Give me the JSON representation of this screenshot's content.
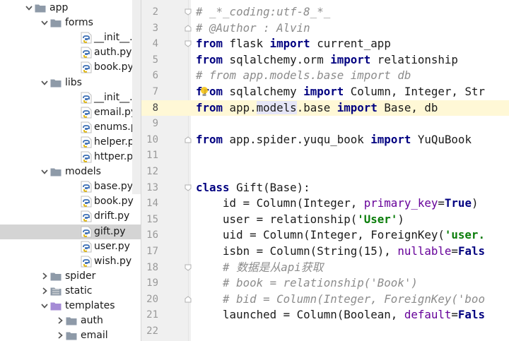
{
  "project_tree": {
    "rows": [
      {
        "label": "app",
        "kind": "folder",
        "depth": 0,
        "arrow": "open"
      },
      {
        "label": "forms",
        "kind": "folder",
        "depth": 1,
        "arrow": "open"
      },
      {
        "label": "__init__.py",
        "kind": "py",
        "depth": 2
      },
      {
        "label": "auth.py",
        "kind": "py",
        "depth": 2
      },
      {
        "label": "book.py",
        "kind": "py",
        "depth": 2
      },
      {
        "label": "libs",
        "kind": "folder",
        "depth": 1,
        "arrow": "open"
      },
      {
        "label": "__init__.py",
        "kind": "py",
        "depth": 2
      },
      {
        "label": "email.py",
        "kind": "py",
        "depth": 2
      },
      {
        "label": "enums.py",
        "kind": "py",
        "depth": 2
      },
      {
        "label": "helper.py",
        "kind": "py",
        "depth": 2
      },
      {
        "label": "httper.py",
        "kind": "py",
        "depth": 2
      },
      {
        "label": "models",
        "kind": "folder",
        "depth": 1,
        "arrow": "open"
      },
      {
        "label": "base.py",
        "kind": "py",
        "depth": 2
      },
      {
        "label": "book.py",
        "kind": "py",
        "depth": 2
      },
      {
        "label": "drift.py",
        "kind": "py",
        "depth": 2
      },
      {
        "label": "gift.py",
        "kind": "py",
        "depth": 2,
        "selected": true
      },
      {
        "label": "user.py",
        "kind": "py",
        "depth": 2
      },
      {
        "label": "wish.py",
        "kind": "py",
        "depth": 2
      },
      {
        "label": "spider",
        "kind": "folder",
        "depth": 1,
        "arrow": "closed"
      },
      {
        "label": "static",
        "kind": "folder-static",
        "depth": 1,
        "arrow": "closed"
      },
      {
        "label": "templates",
        "kind": "folder-purple",
        "depth": 1,
        "arrow": "open"
      },
      {
        "label": "auth",
        "kind": "folder",
        "depth": 2,
        "arrow": "closed"
      },
      {
        "label": "email",
        "kind": "folder",
        "depth": 2,
        "arrow": "closed"
      }
    ]
  },
  "editor": {
    "current_line": 8,
    "lines": [
      {
        "n": 2,
        "fold": "start",
        "tokens": [
          {
            "t": "# _*_coding:utf-8_*_",
            "c": "c"
          }
        ]
      },
      {
        "n": 3,
        "fold": "end",
        "tokens": [
          {
            "t": "# @Author : Alvin",
            "c": "c"
          }
        ]
      },
      {
        "n": 4,
        "fold": "start",
        "tokens": [
          {
            "t": "from",
            "c": "k"
          },
          {
            "t": " flask "
          },
          {
            "t": "import",
            "c": "k"
          },
          {
            "t": " current_app"
          }
        ]
      },
      {
        "n": 5,
        "tokens": [
          {
            "t": "from",
            "c": "k"
          },
          {
            "t": " sqlalchemy.orm "
          },
          {
            "t": "import",
            "c": "k"
          },
          {
            "t": " relationship"
          }
        ]
      },
      {
        "n": 6,
        "tokens": [
          {
            "t": "# from app.models.base import db",
            "c": "c"
          }
        ]
      },
      {
        "n": 7,
        "bulb": true,
        "tokens": [
          {
            "t": "from",
            "c": "k"
          },
          {
            "t": " sqlalchemy "
          },
          {
            "t": "import",
            "c": "k"
          },
          {
            "t": " Column, Integer, Str"
          }
        ]
      },
      {
        "n": 8,
        "tokens": [
          {
            "t": "from",
            "c": "k"
          },
          {
            "t": " app."
          },
          {
            "t": "models",
            "c": "hl"
          },
          {
            "t": ".base "
          },
          {
            "t": "import",
            "c": "k"
          },
          {
            "t": " Base, db"
          }
        ]
      },
      {
        "n": 9,
        "tokens": []
      },
      {
        "n": 10,
        "fold": "end",
        "tokens": [
          {
            "t": "from",
            "c": "k"
          },
          {
            "t": " app.spider.yuqu_book "
          },
          {
            "t": "import",
            "c": "k"
          },
          {
            "t": " YuQuBook"
          }
        ]
      },
      {
        "n": 11,
        "tokens": []
      },
      {
        "n": 12,
        "tokens": []
      },
      {
        "n": 13,
        "fold": "start",
        "tokens": [
          {
            "t": "class",
            "c": "k"
          },
          {
            "t": " Gift(Base):"
          }
        ]
      },
      {
        "n": 14,
        "tokens": [
          {
            "t": "    id = Column(Integer, "
          },
          {
            "t": "primary_key",
            "c": "p"
          },
          {
            "t": "="
          },
          {
            "t": "True",
            "c": "k"
          },
          {
            "t": ")"
          }
        ]
      },
      {
        "n": 15,
        "tokens": [
          {
            "t": "    user = relationship("
          },
          {
            "t": "'User'",
            "c": "s"
          },
          {
            "t": ")"
          }
        ]
      },
      {
        "n": 16,
        "tokens": [
          {
            "t": "    uid = Column(Integer, ForeignKey("
          },
          {
            "t": "'user.",
            "c": "s"
          }
        ]
      },
      {
        "n": 17,
        "tokens": [
          {
            "t": "    isbn = Column(String(15), "
          },
          {
            "t": "nullable",
            "c": "p"
          },
          {
            "t": "="
          },
          {
            "t": "Fals",
            "c": "k"
          }
        ]
      },
      {
        "n": 18,
        "fold": "start",
        "tokens": [
          {
            "t": "    # 数据是从api获取",
            "c": "c"
          }
        ]
      },
      {
        "n": 19,
        "tokens": [
          {
            "t": "    # book = relationship('Book')",
            "c": "c"
          }
        ]
      },
      {
        "n": 20,
        "fold": "end",
        "tokens": [
          {
            "t": "    # bid = Column(Integer, ForeignKey('boo",
            "c": "c"
          }
        ]
      },
      {
        "n": 21,
        "tokens": [
          {
            "t": "    launched = Column(Boolean, "
          },
          {
            "t": "default",
            "c": "p"
          },
          {
            "t": "="
          },
          {
            "t": "Fals",
            "c": "k"
          }
        ]
      },
      {
        "n": 22,
        "tokens": []
      }
    ]
  }
}
